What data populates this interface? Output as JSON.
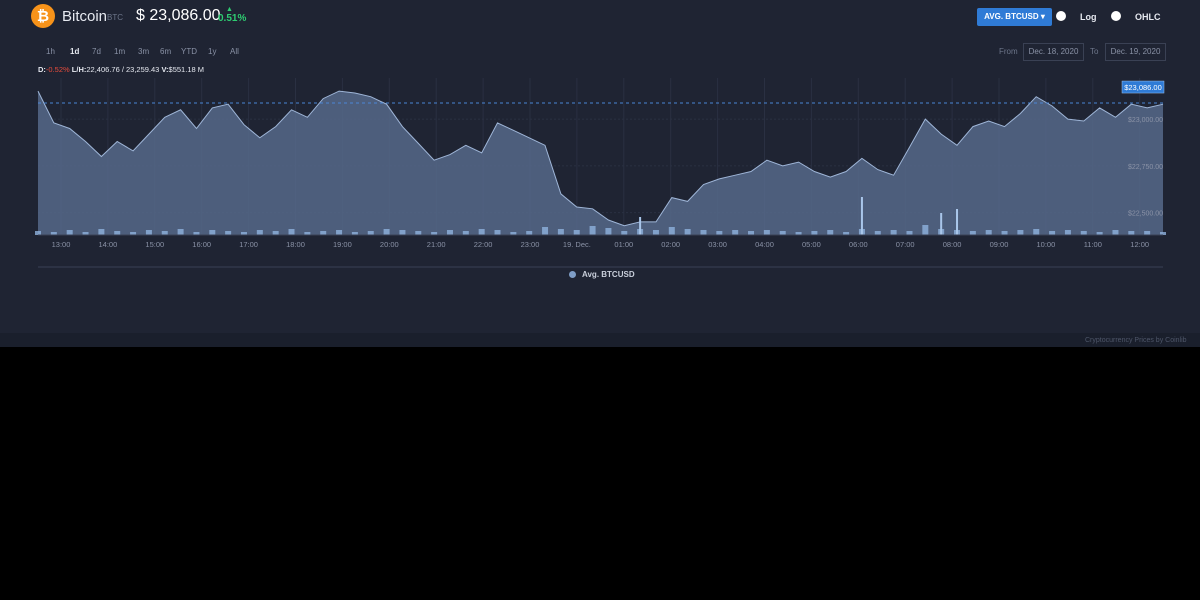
{
  "coin": {
    "name": "Bitcoin",
    "symbol": "BTC",
    "icon": "bitcoin-icon",
    "icon_glyph": "₿",
    "price": "$ 23,086.00",
    "change": "0.51%",
    "change_arrow": "▲"
  },
  "controls": {
    "pair_button": "AVG. BTCUSD",
    "pair_caret": "▾",
    "log_label": "Log",
    "ohlc_label": "OHLC"
  },
  "ranges": [
    "1h",
    "1d",
    "7d",
    "1m",
    "3m",
    "6m",
    "YTD",
    "1y",
    "All"
  ],
  "active_range": "1d",
  "dates": {
    "from_label": "From",
    "from_value": "Dec. 18, 2020",
    "to_label": "To",
    "to_value": "Dec. 19, 2020"
  },
  "stats": {
    "d_label": "D:",
    "d_value": "-0.52%",
    "lh_label": "L/H:",
    "lh_value": "22,406.76 / 23,259.43",
    "v_label": "V:",
    "v_value": "$551.18 M"
  },
  "colors": {
    "background": "#1f2433",
    "area_fill": "#56698a",
    "line": "#9fb6d8",
    "price_badge": "#2f7bd6",
    "positive": "#2ecc71",
    "negative": "#e74c3c",
    "bitcoin": "#f7931a"
  },
  "chart_data": {
    "type": "area",
    "x": [
      "12:40",
      "13:00",
      "13:20",
      "13:40",
      "14:00",
      "14:20",
      "14:40",
      "15:00",
      "15:20",
      "15:40",
      "16:00",
      "16:20",
      "16:40",
      "17:00",
      "17:20",
      "17:40",
      "18:00",
      "18:20",
      "18:40",
      "19:00",
      "19:20",
      "19:40",
      "20:00",
      "20:20",
      "20:40",
      "21:00",
      "21:20",
      "21:40",
      "22:00",
      "22:20",
      "22:40",
      "23:00",
      "23:20",
      "23:40",
      "00:00",
      "00:20",
      "00:40",
      "01:00",
      "01:20",
      "01:40",
      "02:00",
      "02:20",
      "02:40",
      "03:00",
      "03:20",
      "03:40",
      "04:00",
      "04:20",
      "04:40",
      "05:00",
      "05:20",
      "05:40",
      "06:00",
      "06:20",
      "06:40",
      "07:00",
      "07:20",
      "07:40",
      "08:00",
      "08:20",
      "08:40",
      "09:00",
      "09:20",
      "09:40",
      "10:00",
      "10:20",
      "10:40",
      "11:00",
      "11:20",
      "11:40",
      "12:00",
      "12:20"
    ],
    "series": [
      {
        "name": "Avg. BTCUSD",
        "values": [
          23150,
          22980,
          22950,
          22880,
          22800,
          22880,
          22830,
          22920,
          23010,
          23050,
          22950,
          23060,
          23080,
          22970,
          22900,
          22960,
          23050,
          23010,
          23110,
          23150,
          23140,
          23120,
          23080,
          22960,
          22870,
          22780,
          22810,
          22860,
          22820,
          22980,
          22940,
          22900,
          22860,
          22600,
          22530,
          22520,
          22460,
          22430,
          22450,
          22450,
          22580,
          22560,
          22650,
          22680,
          22700,
          22720,
          22780,
          22750,
          22770,
          22720,
          22690,
          22720,
          22790,
          22730,
          22700,
          22850,
          23000,
          22920,
          22860,
          22960,
          22990,
          22960,
          23030,
          23120,
          23070,
          23000,
          22990,
          23060,
          23010,
          23080,
          23060,
          23080
        ]
      }
    ],
    "volume": [
      4,
      3,
      5,
      3,
      6,
      4,
      3,
      5,
      4,
      6,
      3,
      5,
      4,
      3,
      5,
      4,
      6,
      3,
      4,
      5,
      3,
      4,
      6,
      5,
      4,
      3,
      5,
      4,
      6,
      5,
      3,
      4,
      8,
      6,
      5,
      9,
      7,
      4,
      6,
      5,
      8,
      6,
      5,
      4,
      5,
      4,
      5,
      4,
      3,
      4,
      5,
      3,
      6,
      4,
      5,
      4,
      10,
      6,
      5,
      4,
      5,
      4,
      5,
      6,
      4,
      5,
      4,
      3,
      5,
      4,
      4,
      3
    ],
    "volume_spikes": [
      {
        "x": "01:20",
        "v": 18
      },
      {
        "x": "06:00",
        "v": 38
      },
      {
        "x": "07:40",
        "v": 22
      },
      {
        "x": "08:00",
        "v": 26
      }
    ],
    "current_price": 23086,
    "current_price_label": "$23,086.00",
    "y_ticks": [
      {
        "v": 22500,
        "label": "$22,500.00"
      },
      {
        "v": 22750,
        "label": "$22,750.00"
      },
      {
        "v": 23000,
        "label": "$23,000.00"
      }
    ],
    "x_ticks": [
      "13:00",
      "14:00",
      "15:00",
      "16:00",
      "17:00",
      "18:00",
      "19:00",
      "20:00",
      "21:00",
      "22:00",
      "23:00",
      "19. Dec.",
      "01:00",
      "02:00",
      "03:00",
      "04:00",
      "05:00",
      "06:00",
      "07:00",
      "08:00",
      "09:00",
      "10:00",
      "11:00",
      "12:00"
    ],
    "ylim": [
      22380,
      23220
    ],
    "grid": true,
    "legend": "bottom-center"
  },
  "legend_label": "Avg. BTCUSD",
  "credits": "Cryptocurrency Prices by Coinlib"
}
